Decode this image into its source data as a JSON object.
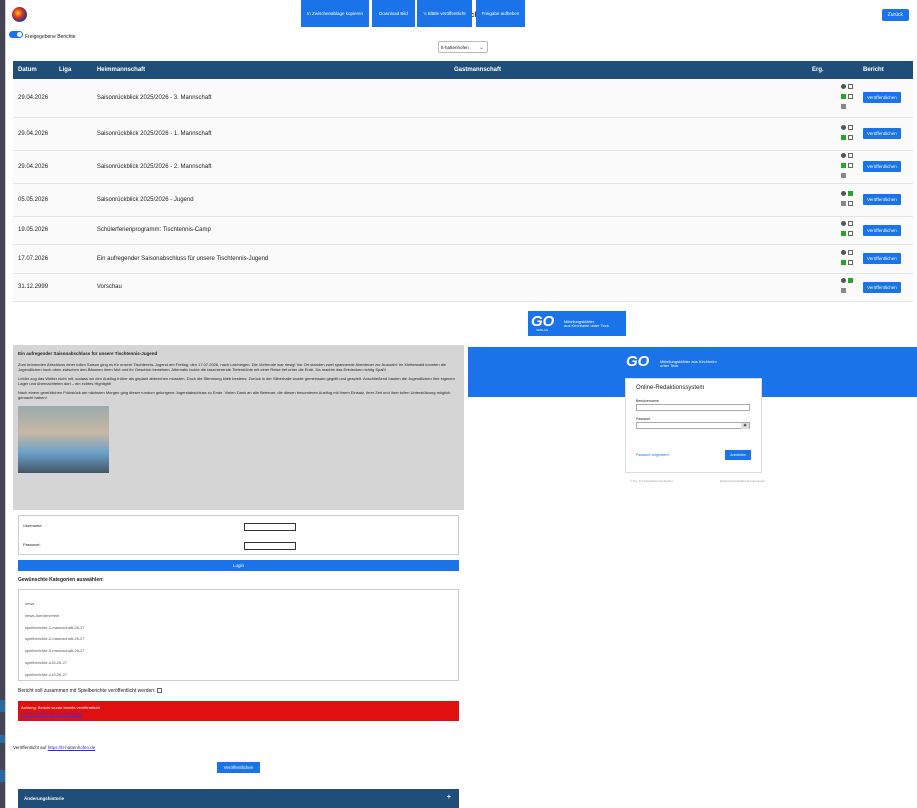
{
  "header": {
    "title": "Veröffentlichen",
    "back_label": "Zurück"
  },
  "toggle": {
    "label": "Freigegebene Berichte"
  },
  "filter": {
    "selected": "tt-hattenhofen"
  },
  "table": {
    "headers": [
      "Datum",
      "Liga",
      "Heimmannschaft",
      "Gastmannschaft",
      "Erg.",
      "Bericht"
    ],
    "publish_label": "Veröffentlichen",
    "rows": [
      {
        "date": "29.04.2026",
        "home": "Saisonrückblick 2025/2026 - 3. Mannschaft"
      },
      {
        "date": "29.04.2026",
        "home": "Saisonrückblick 2025/2026 - 1. Mannschaft"
      },
      {
        "date": "29.04.2026",
        "home": "Saisonrückblick 2025/2026 - 2. Mannschaft"
      },
      {
        "date": "05.05.2026",
        "home": "Saisonrückblick 2025/2026 - Jugend"
      },
      {
        "date": "19.05.2026",
        "home": "Schülerferienprogramm: Tischtennis-Camp"
      },
      {
        "date": "17.07.2026",
        "home": "Ein aufregender Saisonabschluss für unsere Tischtennis-Jugend"
      },
      {
        "date": "31.12.2999",
        "home": "Vorschau"
      }
    ]
  },
  "actions": {
    "copy": "In Zwischenablage kopieren",
    "download": "Download Bild",
    "publish_sheets": "'s Blätle veröffentlicht",
    "revoke": "Freigabe aufheben"
  },
  "go_banner": {
    "logo": "GO",
    "text1": "Mitteilungsblätter",
    "text2": "aus Kirchheim unter Teck",
    "sub": "VERLAG"
  },
  "article": {
    "title": "Ein aufregender Saisonabschluss für unsere Tischtennis-Jugend",
    "p1": "Zum krönenden Abschluss einer tollen Saison ging es für unsere Tischtennis-Jugend am Freitag, den 17.07.2026, nach Laichingen. Die Vorfreude war riesig! Vor Ort standen zwei spannende Abenteuer zur Auswahl: Im Kletterwald konnten die Jugendlichen hoch oben zwischen den Bäumen ihren Mut und ihr Geschick beweisen. Alternativ lockte die faszinierende Tiefenhöhle mit einer Reise tief unter die Erde. Da machte das Entdecken richtig Spaß!",
    "p2": "Leider zog das Wetter nicht mit, sodass wir den Ausflug früher als geplant abbrechen mussten. Doch die Stimmung blieb bestens: Zurück in der Silberhalle wurde gemeinsam gegrillt und gespielt. Anschließend bauten die Jugendlichen ihre eigenen Lager und übernachteten dort – ein echtes Highlight!",
    "p3": "Nach einem gemütlichen Frühstück am nächsten Morgen ging dieser rundum gelungene Jugendabschluss zu Ende. Vielen Dank an alle Betreuer, die diesen besonderen Ausflug mit ihrem Einsatz, ihrer Zeit und ihrer tollen Unterstützung möglich gemacht haben!"
  },
  "login": {
    "username_label": "Username:",
    "password_label": "Passwort:",
    "button": "Login"
  },
  "categories": {
    "heading": "Gewünschte Kategorien auswählen:",
    "items": [
      "news",
      "news-foerderverein",
      "spielberichte-1-mannschaft-26-27",
      "spielberichte-2-mannschaft-26-27",
      "spielberichte-3-mannschaft-26-27",
      "spielberichte-u15-26-27",
      "spielberichte-u19-26-27"
    ]
  },
  "checkbox": {
    "label": "Bericht soll zusammen mit Spielberichte veröffentlicht werden:"
  },
  "alert": {
    "text": "Achtung: Bericht wurde bereits veröffentlicht!",
    "link": "Aus der Tabelle als der Homepage"
  },
  "published_on": {
    "label": "Veröffentlicht auf",
    "link": "https://tt-hattenhofen.de"
  },
  "publish_button": "Veröffentlichen",
  "history": {
    "label": "Änderungshistorie",
    "toggle": "+"
  },
  "cms": {
    "logo": "GO",
    "logo_text": "Mitteilungsblätter aus Kirchheim unter Teck",
    "title": "Online-Redaktionssystem",
    "user_label": "Benutzername",
    "pass_label": "Passwort",
    "forgot": "Passwort vergessen?",
    "submit": "Anmelden",
    "footer_left": "© Top 1% Spiele/Vereins GmbH",
    "footer_right": "Datenschutzerklärung   Impressum"
  }
}
